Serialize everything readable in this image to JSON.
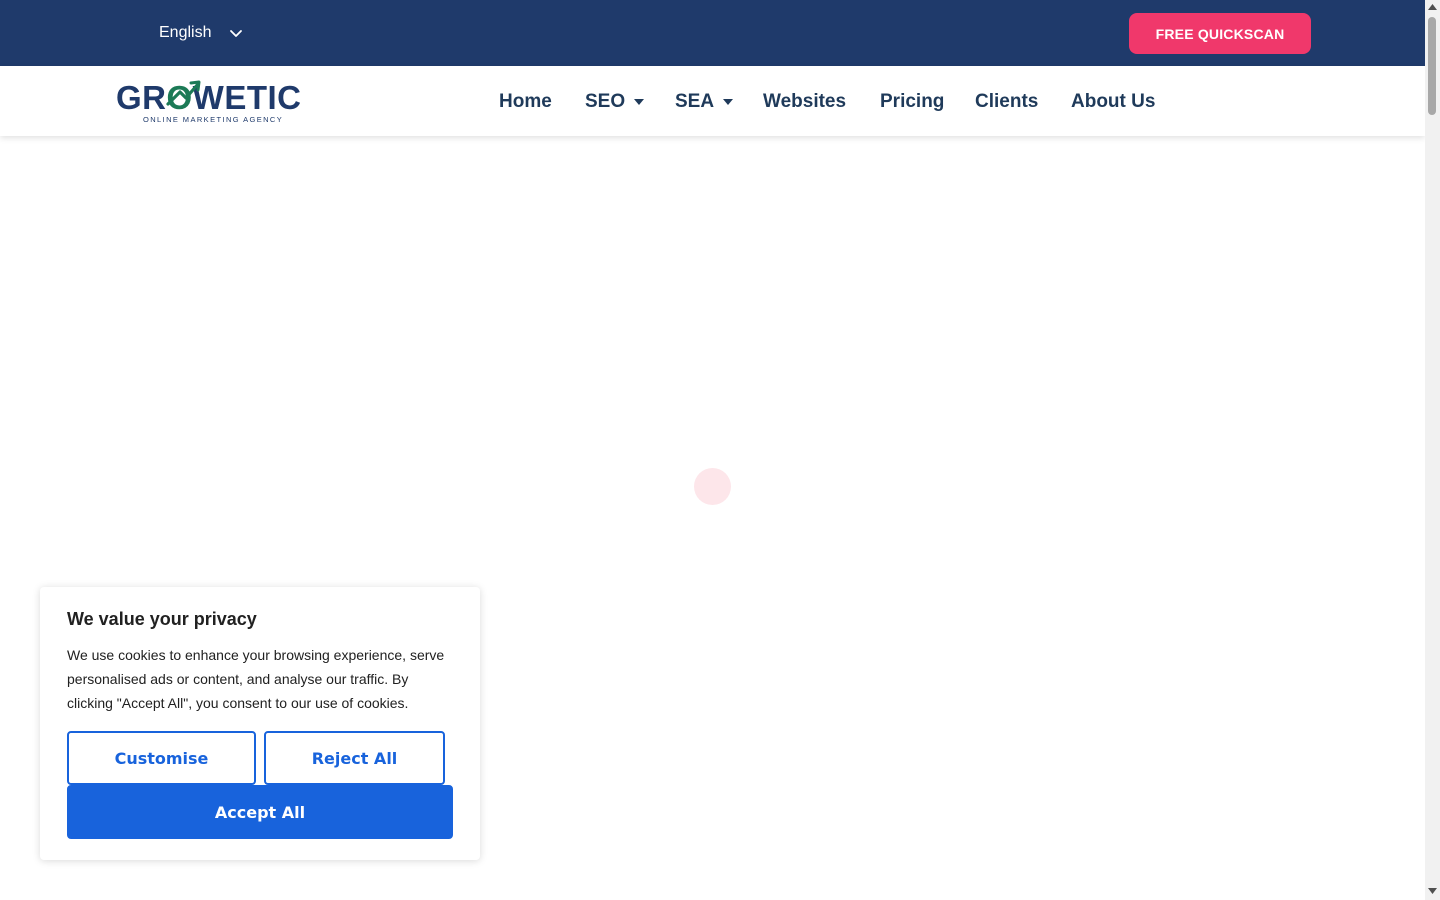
{
  "topbar": {
    "language": "English",
    "cta_label": "FREE QUICKSCAN",
    "bg_color": "#1f3a6b",
    "cta_color": "#f0386b"
  },
  "logo": {
    "text_part1": "GR",
    "text_part2": "O",
    "text_part3": "WETIC",
    "tagline": "ONLINE MARKETING AGENCY"
  },
  "nav": {
    "items": [
      {
        "label": "Home",
        "has_dropdown": false
      },
      {
        "label": "SEO",
        "has_dropdown": true
      },
      {
        "label": "SEA",
        "has_dropdown": true
      },
      {
        "label": "Websites",
        "has_dropdown": false
      },
      {
        "label": "Pricing",
        "has_dropdown": false
      },
      {
        "label": "Clients",
        "has_dropdown": false
      },
      {
        "label": "About Us",
        "has_dropdown": false
      }
    ]
  },
  "cookie": {
    "title": "We value your privacy",
    "body": "We use cookies to enhance your browsing experience, serve personalised ads or content, and analyse our traffic. By clicking \"Accept All\", you consent to our use of cookies.",
    "customise_label": "Customise",
    "reject_label": "Reject All",
    "accept_label": "Accept All",
    "button_color": "#1863dc"
  }
}
